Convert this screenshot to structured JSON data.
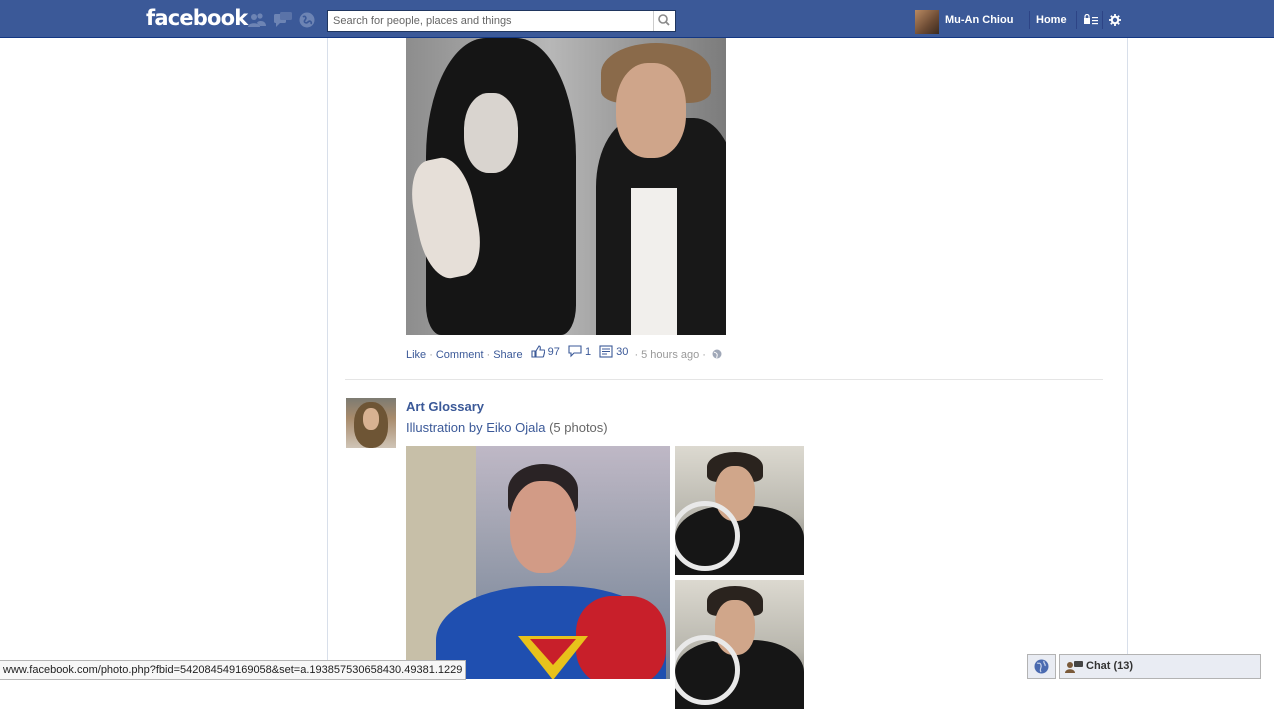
{
  "header": {
    "logo": "facebook",
    "search": {
      "placeholder": "Search for people, places and things"
    },
    "profile_name": "Mu-An Chiou",
    "home_label": "Home"
  },
  "post1": {
    "actions": {
      "like": "Like",
      "comment": "Comment",
      "share": "Share"
    },
    "counts": {
      "likes": "97",
      "comments": "1",
      "shares": "30"
    },
    "timestamp": "5 hours ago"
  },
  "post2": {
    "author": "Art Glossary",
    "album_title": "Illustration by Eiko Ojala",
    "photo_count": "(5 photos)"
  },
  "status_url": "www.facebook.com/photo.php?fbid=542084549169058&set=a.193857530658430.49381.1229",
  "chat": {
    "label": "Chat (13)"
  },
  "colors": {
    "brand": "#3b5998",
    "link": "#3b5998",
    "meta": "#999999"
  },
  "icons": [
    "friend-requests-icon",
    "messages-icon",
    "notifications-icon",
    "search-icon",
    "privacy-shortcuts-icon",
    "settings-gear-icon",
    "like-thumb-icon",
    "comment-bubble-icon",
    "share-icon",
    "globe-icon",
    "chat-icon"
  ]
}
